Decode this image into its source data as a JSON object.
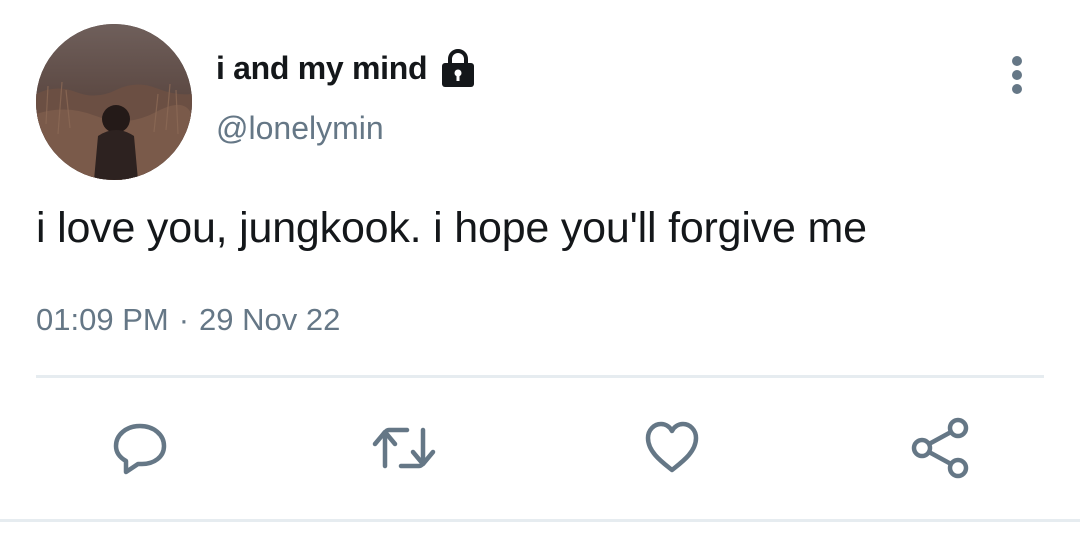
{
  "author": {
    "display_name": "i and my mind",
    "handle": "@lonelymin",
    "avatar_icon": "avatar-photo",
    "protected_icon": "lock-icon"
  },
  "tweet": {
    "text": "i love you, jungkook. i hope you'll forgive me",
    "time": "01:09 PM",
    "separator": "·",
    "date": "29 Nov 22"
  },
  "actions": {
    "reply_icon": "reply-icon",
    "retweet_icon": "retweet-icon",
    "like_icon": "heart-icon",
    "share_icon": "share-icon",
    "more_icon": "more-vertical-icon"
  },
  "colors": {
    "text_primary": "#14171a",
    "text_secondary": "#657786",
    "icon": "#657786",
    "divider": "#e6ecf0"
  }
}
